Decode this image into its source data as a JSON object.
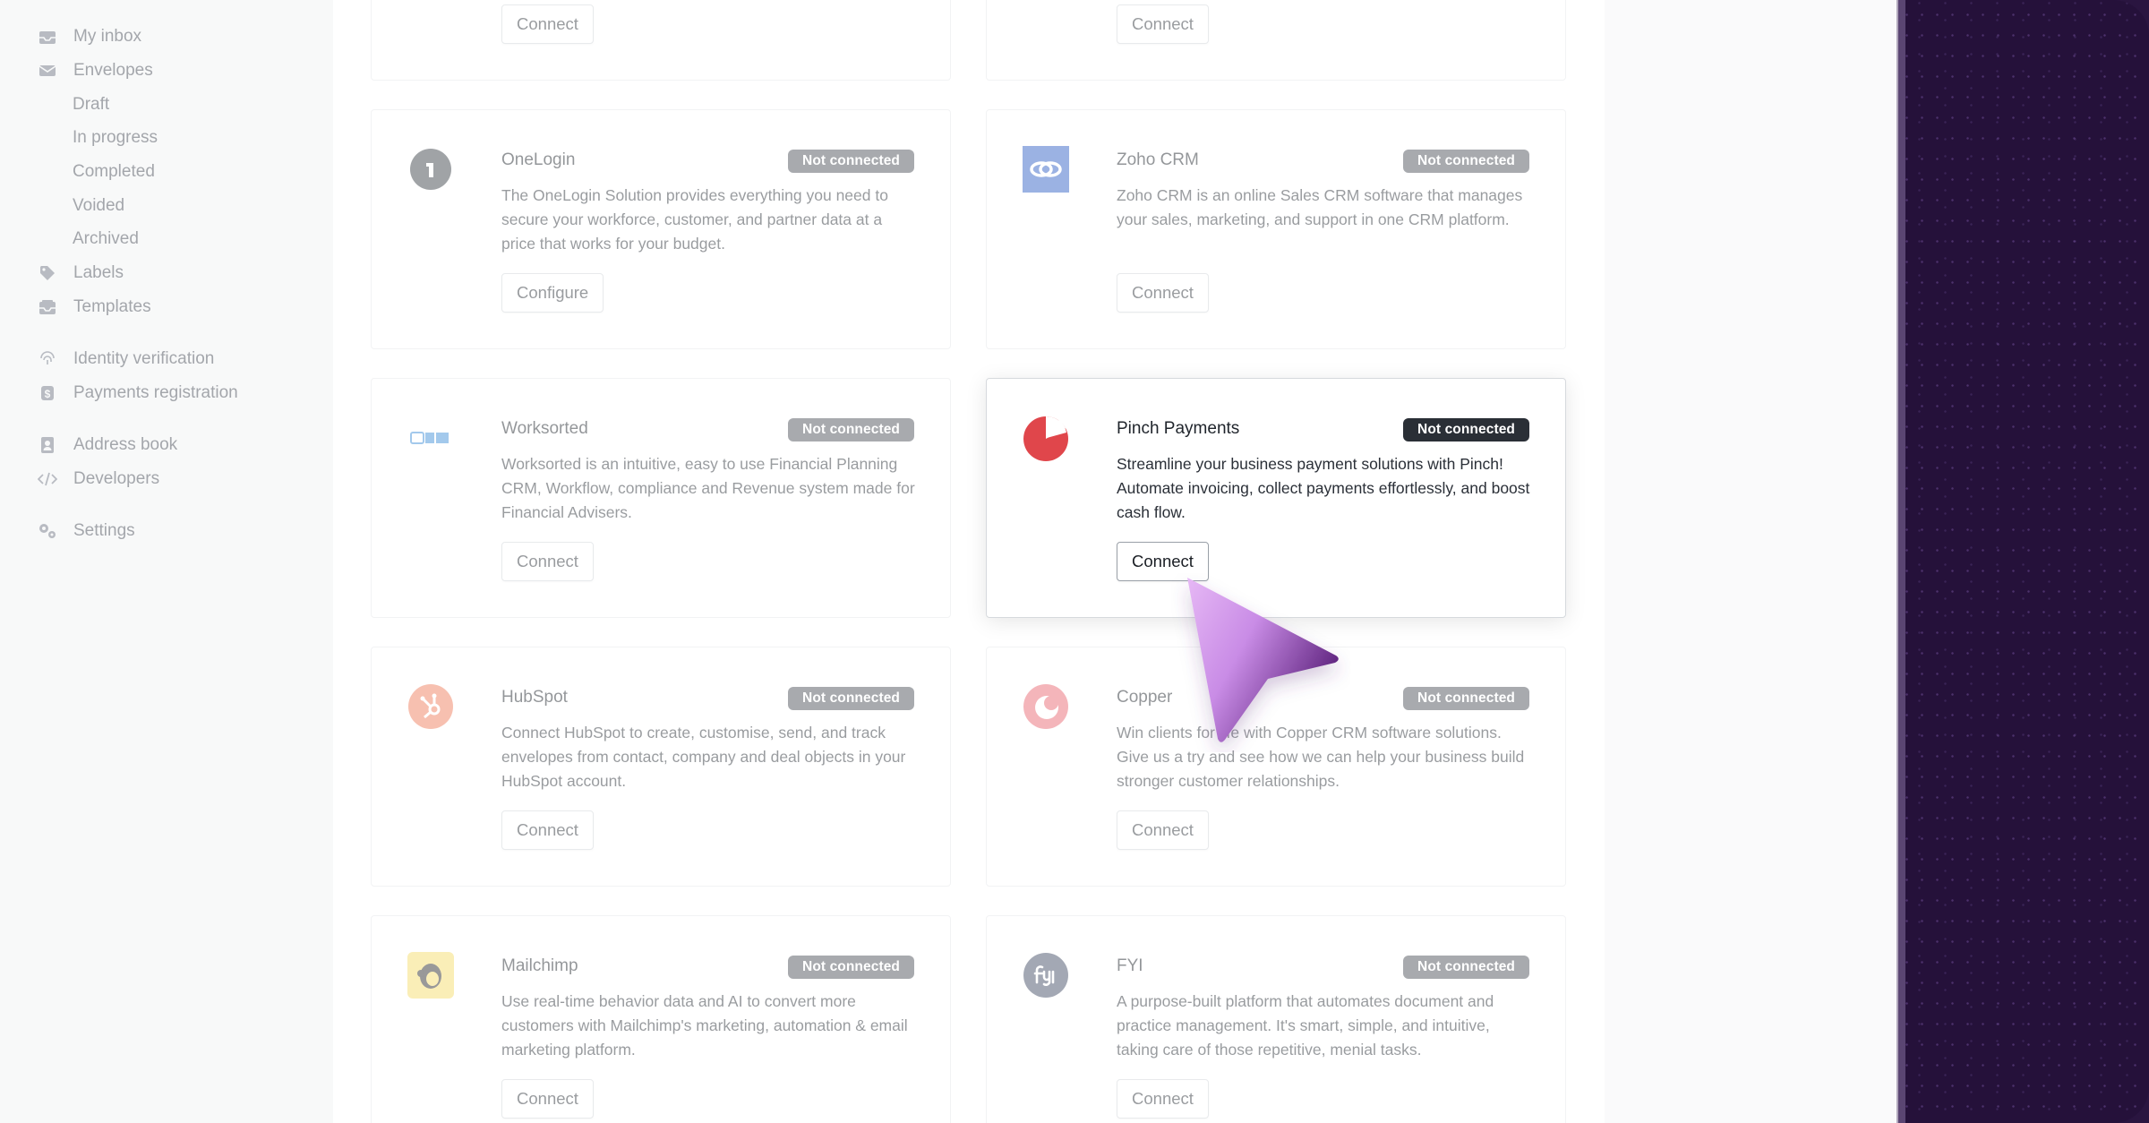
{
  "sidebar": {
    "items": [
      {
        "label": "My inbox",
        "icon": "inbox-icon"
      },
      {
        "label": "Envelopes",
        "icon": "envelope-icon"
      },
      {
        "label": "Draft"
      },
      {
        "label": "In progress"
      },
      {
        "label": "Completed"
      },
      {
        "label": "Voided"
      },
      {
        "label": "Archived"
      },
      {
        "label": "Labels",
        "icon": "tag-icon"
      },
      {
        "label": "Templates",
        "icon": "template-icon"
      },
      {
        "label": "Identity verification",
        "icon": "fingerprint-icon"
      },
      {
        "label": "Payments registration",
        "icon": "dollar-icon"
      },
      {
        "label": "Address book",
        "icon": "contact-book-icon"
      },
      {
        "label": "Developers",
        "icon": "code-icon"
      },
      {
        "label": "Settings",
        "icon": "gears-icon"
      }
    ]
  },
  "integrations": [
    {
      "name": "",
      "status": "",
      "description": "",
      "action": "Connect"
    },
    {
      "name": "",
      "status": "",
      "description": "",
      "action": "Connect"
    },
    {
      "name": "OneLogin",
      "status": "Not connected",
      "description": "The OneLogin Solution provides everything you need to secure your workforce, customer, and partner data at a price that works for your budget.",
      "action": "Configure",
      "icon": "onelogin-logo-icon",
      "color": "#3a3f46"
    },
    {
      "name": "Zoho CRM",
      "status": "Not connected",
      "description": "Zoho CRM is an online Sales CRM software that manages your sales, marketing, and support in one CRM platform.",
      "action": "Connect",
      "icon": "zoho-crm-logo-icon",
      "color": "#2f5fc4"
    },
    {
      "name": "Worksorted",
      "status": "Not connected",
      "description": "Worksorted is an intuitive, easy to use Financial Planning CRM, Workflow, compliance and Revenue system made for Financial Advisers.",
      "action": "Connect",
      "icon": "worksorted-logo-icon",
      "color": "#3f8fd8"
    },
    {
      "name": "Pinch Payments",
      "status": "Not connected",
      "description": "Streamline your business payment solutions with Pinch! Automate invoicing, collect payments effortlessly, and boost cash flow.",
      "action": "Connect",
      "icon": "pinch-payments-logo-icon",
      "color": "#e0464b"
    },
    {
      "name": "HubSpot",
      "status": "Not connected",
      "description": "Connect HubSpot to create, customise, send, and track envelopes from contact, company and deal objects in your HubSpot account.",
      "action": "Connect",
      "icon": "hubspot-logo-icon",
      "color": "#ef7b5a"
    },
    {
      "name": "Copper",
      "status": "Not connected",
      "description": "Win clients for life with Copper CRM software solutions. Give us a try and see how we can help your business build stronger customer relationships.",
      "action": "Connect",
      "icon": "copper-logo-icon",
      "color": "#e9656f"
    },
    {
      "name": "Mailchimp",
      "status": "Not connected",
      "description": "Use real-time behavior data and AI to convert more customers with Mailchimp's marketing, automation & email marketing platform.",
      "action": "Connect",
      "icon": "mailchimp-logo-icon",
      "color": "#f4dc6a"
    },
    {
      "name": "FYI",
      "status": "Not connected",
      "description": "A purpose-built platform that automates document and practice management. It's smart, simple, and intuitive, taking care of those repetitive, menial tasks.",
      "action": "Connect",
      "icon": "fyi-logo-icon",
      "color": "#3f4a63"
    }
  ]
}
